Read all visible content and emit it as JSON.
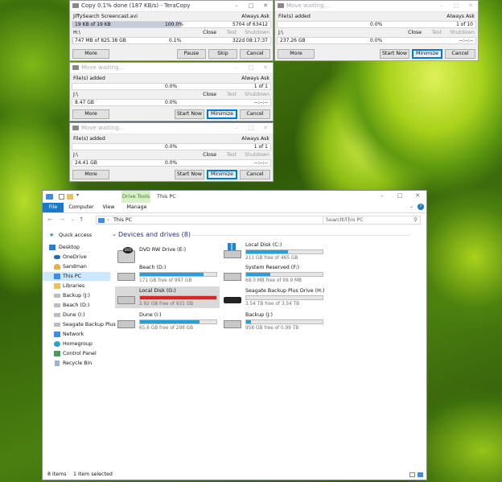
{
  "teracopy_main": {
    "title": "Copy 0.1% done (187 KB/s) - TeraCopy",
    "filename": "JiffySearch Screencast.avi",
    "always_ask": "Always Ask",
    "progress1_left": "19 KB of 19 KB",
    "progress1_pct": "100.0%",
    "progress1_right": "5704 of 63412",
    "dest": "H:\\",
    "close": "Close",
    "test": "Test",
    "shutdown": "Shutdown",
    "progress2_left": "747 MB of 825.38 GB",
    "progress2_pct": "0.1%",
    "progress2_right": "322d 08:17:37",
    "btn_more": "More",
    "btn_pause": "Pause",
    "btn_skip": "Skip",
    "btn_cancel": "Cancel",
    "progress1_fraction": 1.0,
    "progress2_fraction": 0.001
  },
  "teracopy_windows": [
    {
      "title": "Move waiting...",
      "files_added": "File(s) added",
      "always_ask": "Always Ask",
      "p1_pct": "0.0%",
      "p1_right": "1 of 10",
      "dest": "J:\\",
      "close": "Close",
      "test": "Test",
      "shutdown": "Shutdown",
      "p2_left": "237.26 GB",
      "p2_pct": "0.0%",
      "p2_right": "--:--:--",
      "btn_more": "More",
      "btn_start": "Start Now",
      "btn_minimize": "Minimize",
      "btn_cancel": "Cancel"
    },
    {
      "title": "Move waiting...",
      "files_added": "File(s) added",
      "always_ask": "Always Ask",
      "p1_pct": "0.0%",
      "p1_right": "1 of 1",
      "dest": "J:\\",
      "close": "Close",
      "test": "Test",
      "shutdown": "Shutdown",
      "p2_left": "8.47 GB",
      "p2_pct": "0.0%",
      "p2_right": "--:--:--",
      "btn_more": "More",
      "btn_start": "Start Now",
      "btn_minimize": "Minimize",
      "btn_cancel": "Cancel"
    },
    {
      "title": "Move waiting...",
      "files_added": "File(s) added",
      "always_ask": "Always Ask",
      "p1_pct": "0.0%",
      "p1_right": "1 of 1",
      "dest": "J:\\",
      "close": "Close",
      "test": "Test",
      "shutdown": "Shutdown",
      "p2_left": "24.41 GB",
      "p2_pct": "0.0%",
      "p2_right": "--:--:--",
      "btn_more": "More",
      "btn_start": "Start Now",
      "btn_minimize": "Minimize",
      "btn_cancel": "Cancel"
    }
  ],
  "explorer": {
    "title": "This PC",
    "drive_tools": "Drive Tools",
    "tabs": [
      "File",
      "Computer",
      "View",
      "Manage"
    ],
    "address": "This PC",
    "search_placeholder": "Search This PC",
    "group_title": "Devices and drives (8)",
    "nav": [
      {
        "label": "Quick access",
        "icon": "star-icon"
      },
      {
        "label": "Desktop",
        "icon": "desktop-icon"
      },
      {
        "label": "OneDrive",
        "icon": "cloud-icon"
      },
      {
        "label": "Sandman",
        "icon": "user-icon"
      },
      {
        "label": "This PC",
        "icon": "computer-icon"
      },
      {
        "label": "Libraries",
        "icon": "library-icon"
      },
      {
        "label": "Backup (J:)",
        "icon": "drive-icon"
      },
      {
        "label": "Beach (D:)",
        "icon": "drive-icon"
      },
      {
        "label": "Dune (I:)",
        "icon": "drive-icon"
      },
      {
        "label": "Seagate Backup Plus",
        "icon": "drive-icon"
      },
      {
        "label": "Network",
        "icon": "network-icon"
      },
      {
        "label": "Homegroup",
        "icon": "homegroup-icon"
      },
      {
        "label": "Control Panel",
        "icon": "control-panel-icon"
      },
      {
        "label": "Recycle Bin",
        "icon": "recycle-bin-icon"
      }
    ],
    "drives": [
      {
        "name": "DVD RW Drive (E:)",
        "free": "",
        "used_fraction": null,
        "bar_color": "",
        "icon": "dvd-drive-icon"
      },
      {
        "name": "Local Disk (C:)",
        "free": "211 GB free of 465 GB",
        "used_fraction": 0.55,
        "bar_color": "#26a0da",
        "icon": "windows-drive-icon"
      },
      {
        "name": "Beach (D:)",
        "free": "171 GB free of 997 GB",
        "used_fraction": 0.83,
        "bar_color": "#26a0da",
        "icon": "drive-icon"
      },
      {
        "name": "System Reserved (F:)",
        "free": "68.0 MB free of 99.9 MB",
        "used_fraction": 0.32,
        "bar_color": "#26a0da",
        "icon": "drive-icon"
      },
      {
        "name": "Local Disk (G:)",
        "free": "2.92 GB free of 931 GB",
        "used_fraction": 0.997,
        "bar_color": "#da2626",
        "icon": "drive-icon"
      },
      {
        "name": "Seagate Backup Plus Drive (H:)",
        "free": "3.54 TB free of 3.54 TB",
        "used_fraction": 0.0,
        "bar_color": "#26a0da",
        "icon": "external-drive-icon"
      },
      {
        "name": "Dune (I:)",
        "free": "65.6 GB free of 298 GB",
        "used_fraction": 0.78,
        "bar_color": "#26a0da",
        "icon": "drive-icon"
      },
      {
        "name": "Backup (J:)",
        "free": "958 GB free of 0.99 TB",
        "used_fraction": 0.06,
        "bar_color": "#26a0da",
        "icon": "drive-icon"
      }
    ],
    "status_items": "8 items",
    "status_selected": "1 item selected"
  }
}
